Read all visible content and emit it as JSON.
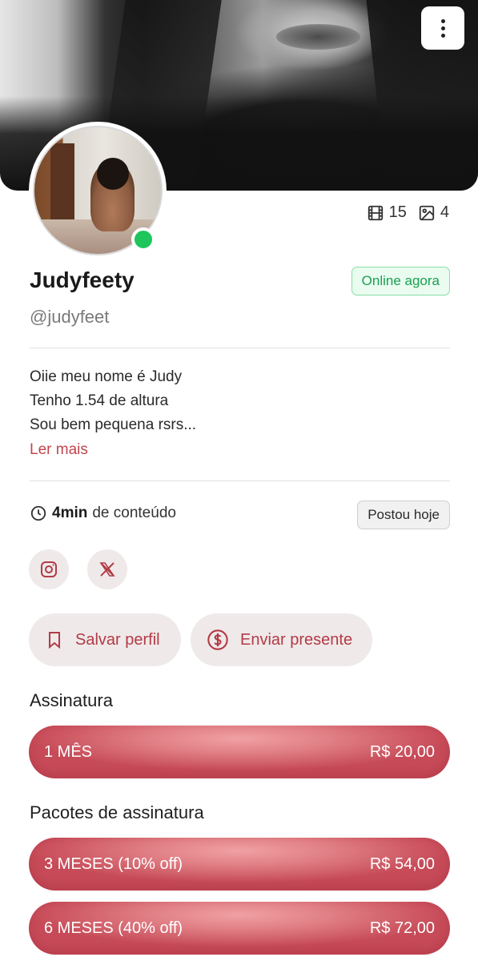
{
  "header": {
    "menu_icon": "more-vertical-icon"
  },
  "profile": {
    "name": "Judyfeety",
    "handle": "@judyfeet",
    "online_badge": "Online agora",
    "videos_count": "15",
    "photos_count": "4",
    "bio_lines": [
      "Oiie meu nome é Judy",
      "Tenho 1.54 de altura",
      "Sou bem pequena rsrs..."
    ],
    "read_more": "Ler mais",
    "content_duration": "4min",
    "content_suffix": "de conteúdo",
    "posted_badge": "Postou hoje"
  },
  "social": {
    "instagram_icon": "instagram-icon",
    "x_icon": "x-icon"
  },
  "actions": {
    "save_label": "Salvar perfil",
    "gift_label": "Enviar presente"
  },
  "subscription": {
    "title": "Assinatura",
    "plans": [
      {
        "label": "1 MÊS",
        "price": "R$ 20,00"
      }
    ]
  },
  "packages": {
    "title": "Pacotes de assinatura",
    "plans": [
      {
        "label": "3 MESES (10% off)",
        "price": "R$ 54,00"
      },
      {
        "label": "6 MESES (40% off)",
        "price": "R$ 72,00"
      }
    ]
  },
  "colors": {
    "accent": "#c2454d",
    "online_green": "#1ec55b",
    "plan_gradient_light": "#f0a1a3",
    "plan_gradient_dark": "#c64a57"
  }
}
